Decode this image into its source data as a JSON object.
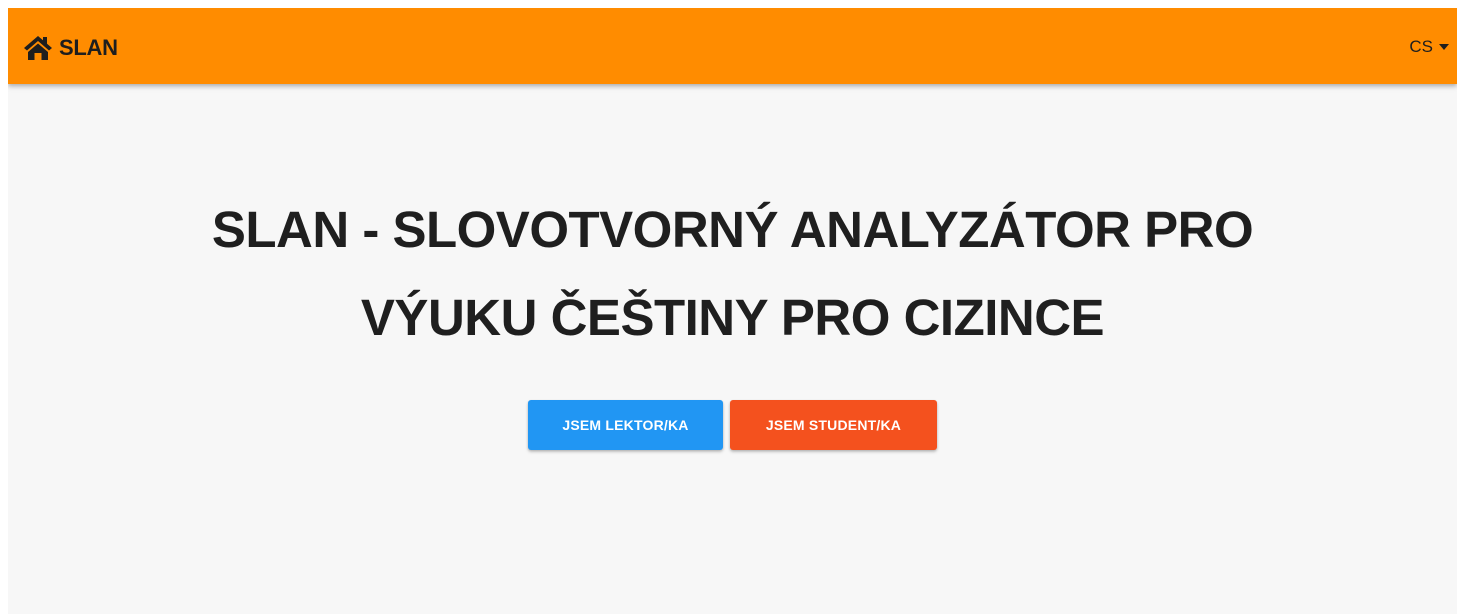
{
  "appbar": {
    "brand_label": "SLAN",
    "brand_icon": "home-icon",
    "language_label": "CS",
    "language_icon": "caret-down-icon",
    "color": "#ff8c00"
  },
  "hero": {
    "title": "SLAN - SLOVOTVORNÝ ANALYZÁTOR PRO VÝUKU ČEŠTINY PRO CIZINCE"
  },
  "actions": {
    "lector_label": "JSEM LEKTOR/KA",
    "lector_color": "#2196f3",
    "student_label": "JSEM STUDENT/KA",
    "student_color": "#f4511e"
  }
}
